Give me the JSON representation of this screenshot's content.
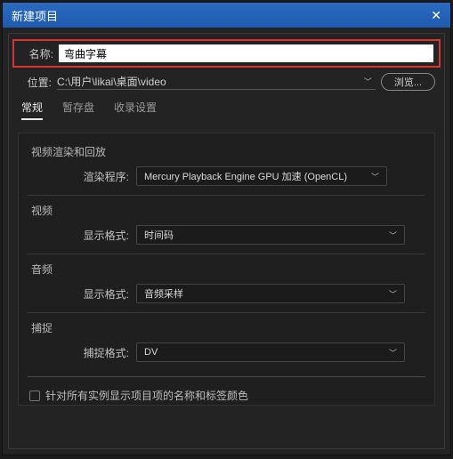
{
  "titlebar": {
    "title": "新建项目"
  },
  "name": {
    "label": "名称:",
    "value": "弯曲字幕"
  },
  "location": {
    "label": "位置:",
    "value": "C:\\用户\\likai\\桌面\\video",
    "browse": "浏览..."
  },
  "tabs": {
    "general": "常规",
    "scratch": "暂存盘",
    "ingest": "收录设置"
  },
  "sections": {
    "playback": {
      "title": "视频渲染和回放",
      "renderer_label": "渲染程序:",
      "renderer_value": "Mercury Playback Engine GPU 加速 (OpenCL)"
    },
    "video": {
      "title": "视频",
      "format_label": "显示格式:",
      "format_value": "时间码"
    },
    "audio": {
      "title": "音频",
      "format_label": "显示格式:",
      "format_value": "音频采样"
    },
    "capture": {
      "title": "捕捉",
      "format_label": "捕捉格式:",
      "format_value": "DV"
    }
  },
  "checkbox": {
    "label": "针对所有实例显示项目项的名称和标签颜色"
  }
}
